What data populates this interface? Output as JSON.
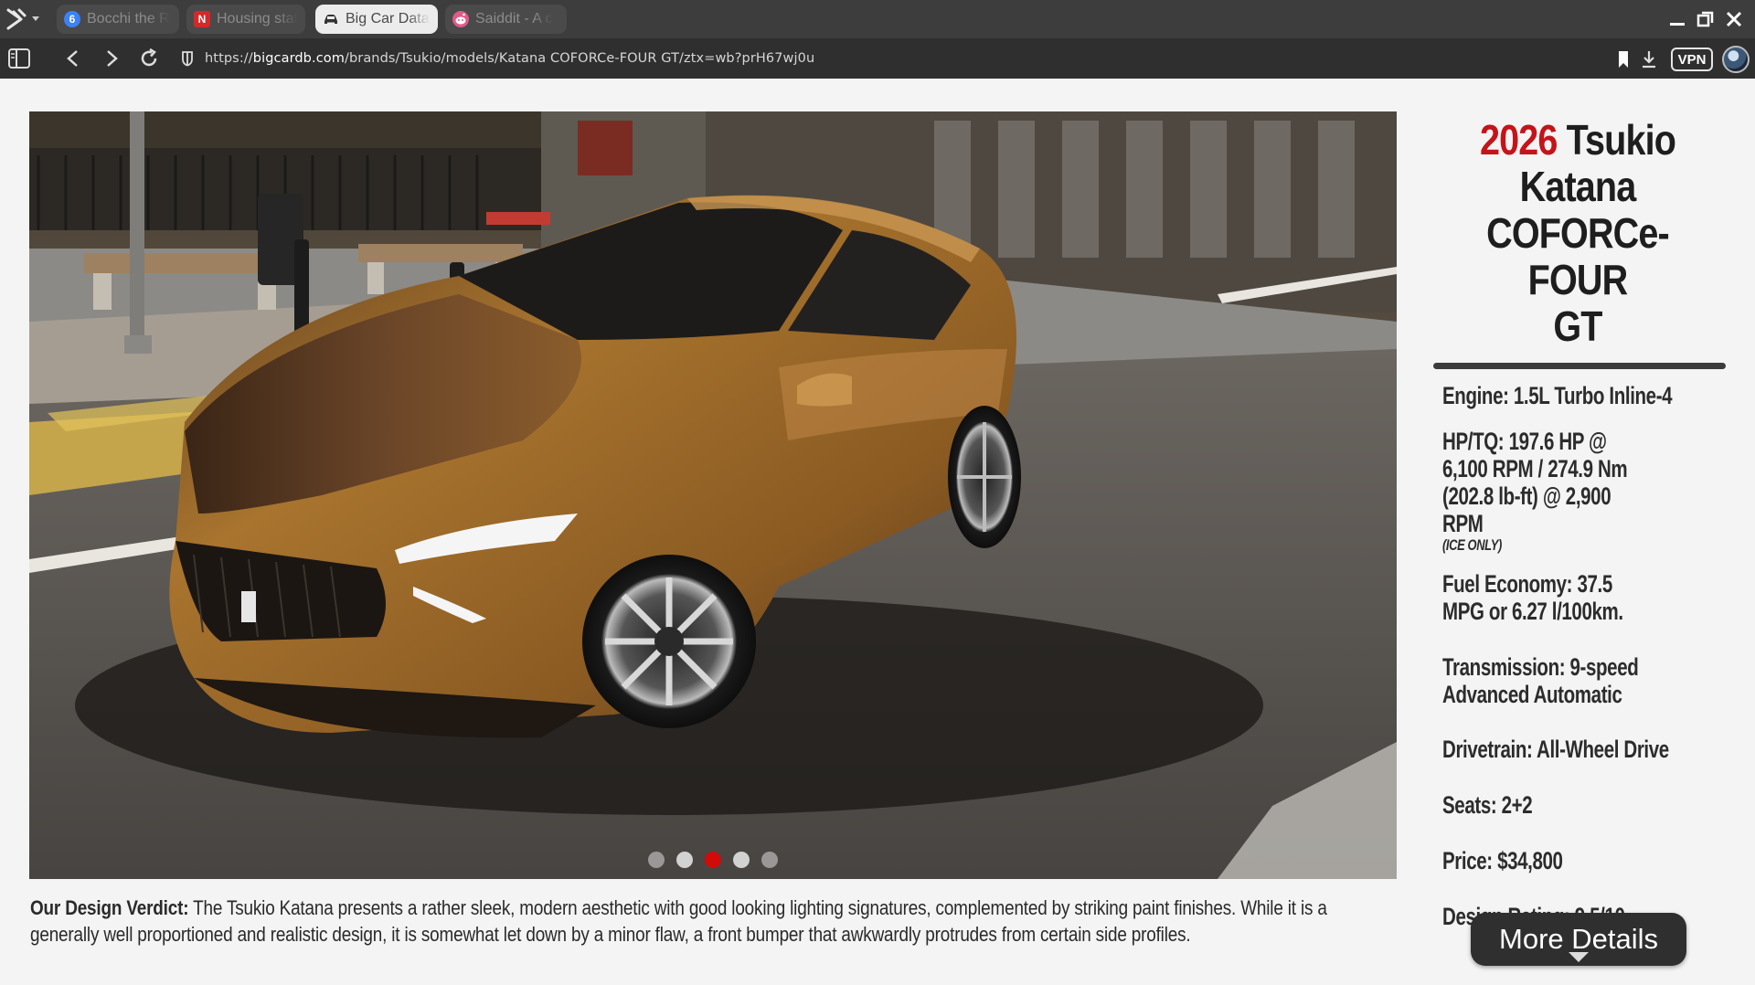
{
  "browser": {
    "tabs": [
      {
        "label": "Bocchi the R",
        "favicon": "6",
        "favicon_color": "#3b82f6",
        "active": false
      },
      {
        "label": "Housing stat",
        "favicon": "N",
        "favicon_color": "#d62828",
        "active": false
      },
      {
        "label": "Big Car Data",
        "favicon": "car-icon",
        "favicon_color": "#333333",
        "active": true
      },
      {
        "label": "Saiddit - A c",
        "favicon": "alien-icon",
        "favicon_color": "#e05a8a",
        "active": false
      }
    ],
    "url_scheme": "https://",
    "url_host": "bigcardb.com",
    "url_path": "/brands/Tsukio/models/Katana COFORCe-FOUR GT/ztx=wb?prH67wj0u",
    "vpn_label": "VPN"
  },
  "gallery": {
    "slide_count": 5,
    "active_slide": 3,
    "accent_color": "#d10a0a"
  },
  "verdict": {
    "label": "Our Design Verdict:",
    "text": " The Tsukio Katana presents a rather sleek, modern aesthetic with good looking lighting signatures, complemented by striking paint finishes. While it is a generally well proportioned and realistic design, it is somewhat let down by a minor flaw, a front bumper that awkwardly protrudes from certain side profiles."
  },
  "car": {
    "year": "2026",
    "name_line1": "Tsukio",
    "name_line2": "Katana",
    "name_line3": "COFORCe-FOUR",
    "name_line4": "GT",
    "year_color": "#c4141a"
  },
  "specs": {
    "engine": "Engine: 1.5L Turbo Inline-4",
    "hp_tq": "HP/TQ: 197.6 HP @ 6,100 RPM / 274.9 Nm (202.8 lb-ft) @ 2,900 RPM",
    "hp_tq_note": "(ICE ONLY)",
    "fuel": "Fuel Economy: 37.5 MPG or 6.27 l/100km.",
    "transmission": "Transmission: 9-speed Advanced Automatic",
    "drivetrain": "Drivetrain: All-Wheel Drive",
    "seats": "Seats: 2+2",
    "price": "Price: $34,800",
    "rating": "Design Rating: 9.5/10"
  },
  "more_button": "More Details"
}
